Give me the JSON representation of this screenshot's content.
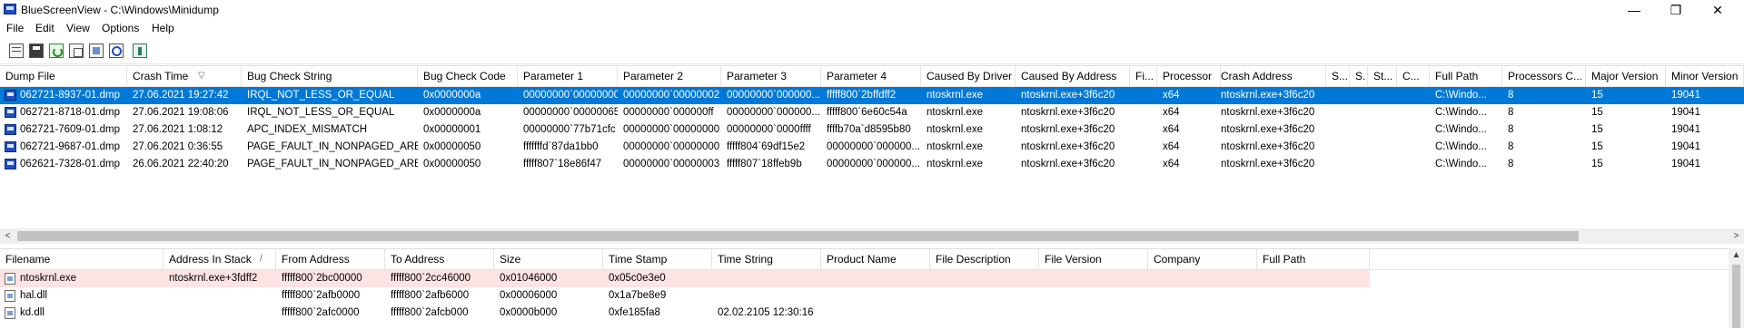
{
  "window": {
    "title": "BlueScreenView  -  C:\\Windows\\Minidump",
    "minimize_glyph": "—",
    "maximize_glyph": "❐",
    "close_glyph": "✕"
  },
  "menu": [
    "File",
    "Edit",
    "View",
    "Options",
    "Help"
  ],
  "toolbar": {
    "icons": [
      "properties-icon",
      "save-icon",
      "refresh-icon",
      "copy-icon",
      "html-report-icon",
      "find-icon",
      "exit-icon"
    ]
  },
  "crash_list": {
    "columns": [
      "Dump File",
      "Crash Time",
      "Bug Check String",
      "Bug Check Code",
      "Parameter 1",
      "Parameter 2",
      "Parameter 3",
      "Parameter 4",
      "Caused By Driver",
      "Caused By Address",
      "Fi...",
      "Processor",
      "Crash Address",
      "S...",
      "S.",
      "St...",
      "C...",
      "Full Path",
      "Processors C...",
      "Major Version",
      "Minor Version"
    ],
    "sort_glyph": "▽",
    "rows": [
      [
        "062721-8937-01.dmp",
        "27.06.2021 19:27:42",
        "IRQL_NOT_LESS_OR_EQUAL",
        "0x0000000a",
        "00000000`00000000",
        "00000000`00000002",
        "00000000`000000...",
        "fffff800`2bffdff2",
        "ntoskrnl.exe",
        "ntoskrnl.exe+3f6c20",
        "",
        "x64",
        "ntoskrnl.exe+3f6c20",
        "",
        "",
        "",
        "",
        "C:\\Windo...",
        "8",
        "15",
        "19041"
      ],
      [
        "062721-8718-01.dmp",
        "27.06.2021 19:08:06",
        "IRQL_NOT_LESS_OR_EQUAL",
        "0x0000000a",
        "00000000`00000065",
        "00000000`000000ff",
        "00000000`000000...",
        "fffff800`6e60c54a",
        "ntoskrnl.exe",
        "ntoskrnl.exe+3f6c20",
        "",
        "x64",
        "ntoskrnl.exe+3f6c20",
        "",
        "",
        "",
        "",
        "C:\\Windo...",
        "8",
        "15",
        "19041"
      ],
      [
        "062721-7609-01.dmp",
        "27.06.2021 1:08:12",
        "APC_INDEX_MISMATCH",
        "0x00000001",
        "00000000`77b71cfc",
        "00000000`00000000",
        "00000000`0000ffff",
        "ffffb70a`d8595b80",
        "ntoskrnl.exe",
        "ntoskrnl.exe+3f6c20",
        "",
        "x64",
        "ntoskrnl.exe+3f6c20",
        "",
        "",
        "",
        "",
        "C:\\Windo...",
        "8",
        "15",
        "19041"
      ],
      [
        "062721-9687-01.dmp",
        "27.06.2021 0:36:55",
        "PAGE_FAULT_IN_NONPAGED_AREA",
        "0x00000050",
        "fffffffd`87da1bb0",
        "00000000`00000000",
        "fffff804`69df15e2",
        "00000000`000000...",
        "ntoskrnl.exe",
        "ntoskrnl.exe+3f6c20",
        "",
        "x64",
        "ntoskrnl.exe+3f6c20",
        "",
        "",
        "",
        "",
        "C:\\Windo...",
        "8",
        "15",
        "19041"
      ],
      [
        "062621-7328-01.dmp",
        "26.06.2021 22:40:20",
        "PAGE_FAULT_IN_NONPAGED_AREA",
        "0x00000050",
        "fffff807`18e86f47",
        "00000000`00000003",
        "fffff807`18ffeb9b",
        "00000000`000000...",
        "ntoskrnl.exe",
        "ntoskrnl.exe+3f6c20",
        "",
        "x64",
        "ntoskrnl.exe+3f6c20",
        "",
        "",
        "",
        "",
        "C:\\Windo...",
        "8",
        "15",
        "19041"
      ]
    ],
    "selected_row": 0
  },
  "scrollbar": {
    "left_glyph": "<",
    "right_glyph": ">"
  },
  "module_list": {
    "columns": [
      "Filename",
      "Address In Stack",
      "From Address",
      "To Address",
      "Size",
      "Time Stamp",
      "Time String",
      "Product Name",
      "File Description",
      "File Version",
      "Company",
      "Full Path"
    ],
    "sort_glyph": "/",
    "rows": [
      [
        "ntoskrnl.exe",
        "ntoskrnl.exe+3fdff2",
        "fffff800`2bc00000",
        "fffff800`2cc46000",
        "0x01046000",
        "0x05c0e3e0",
        "",
        "",
        "",
        "",
        "",
        ""
      ],
      [
        "hal.dll",
        "",
        "fffff800`2afb0000",
        "fffff800`2afb6000",
        "0x00006000",
        "0x1a7be8e9",
        "",
        "",
        "",
        "",
        "",
        ""
      ],
      [
        "kd.dll",
        "",
        "fffff800`2afc0000",
        "fffff800`2afcb000",
        "0x0000b000",
        "0xfe185fa8",
        "02.02.2105 12:30:16",
        "",
        "",
        "",
        "",
        ""
      ]
    ],
    "highlighted_row": 0,
    "vscroll_up_glyph": "▲"
  },
  "colors": {
    "selection": "#0078d7",
    "highlight": "#fde3e3"
  }
}
